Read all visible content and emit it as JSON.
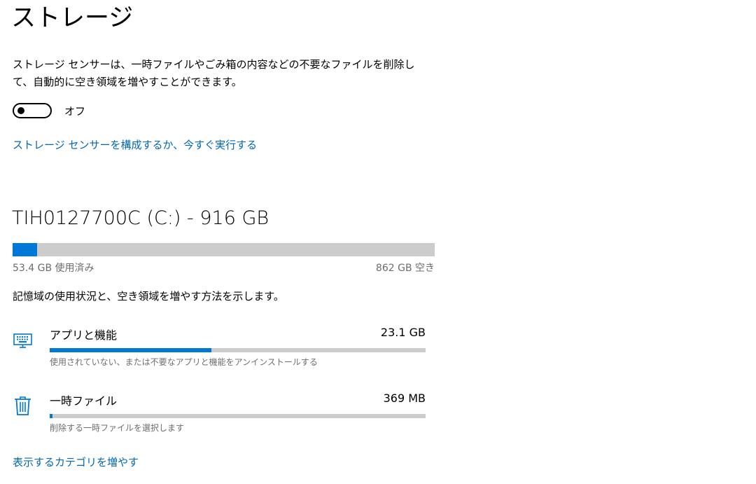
{
  "page": {
    "title": "ストレージ"
  },
  "storage_sense": {
    "description": "ストレージ センサーは、一時ファイルやごみ箱の内容などの不要なファイルを削除して、自動的に空き領域を増やすことができます。",
    "toggle_state": "オフ",
    "toggle_on": false,
    "configure_link": "ストレージ センサーを構成するか、今すぐ実行する"
  },
  "drive": {
    "title": "TIH0127700C (C:) - 916 GB",
    "used": "53.4 GB 使用済み",
    "free": "862 GB 空き",
    "used_fraction": 0.058,
    "description": "記憶域の使用状況と、空き領域を増やす方法を示します。"
  },
  "categories": [
    {
      "label": "アプリと機能",
      "size": "23.1 GB",
      "hint": "使用されていない、または不要なアプリと機能をアンインストールする",
      "fraction": 0.43,
      "icon": "keyboard-icon"
    },
    {
      "label": "一時ファイル",
      "size": "369 MB",
      "hint": "削除する一時ファイルを選択します",
      "fraction": 0.007,
      "icon": "trash-icon"
    }
  ],
  "more_link": "表示するカテゴリを増やす",
  "colors": {
    "accent": "#0078d7",
    "link": "#0067b8",
    "bar_track": "#cccccc"
  }
}
